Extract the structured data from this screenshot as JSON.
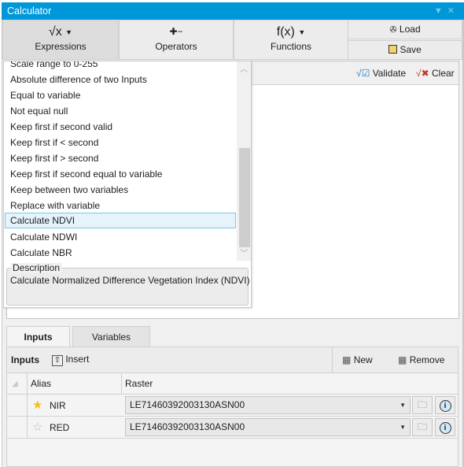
{
  "window": {
    "title": "Calculator"
  },
  "ribbon": {
    "expressions": {
      "label": "Expressions",
      "icon": "sqrt-x-icon"
    },
    "operators": {
      "label": "Operators",
      "icon": "operators-icon"
    },
    "functions": {
      "label": "Functions",
      "icon_text": "f(x)"
    },
    "load": {
      "label": "Load"
    },
    "save": {
      "label": "Save"
    }
  },
  "editor": {
    "validate_label": "Validate",
    "clear_label": "Clear",
    "content": ""
  },
  "expressions_dropdown": {
    "items": [
      "Scale range to 0-255",
      "Absolute difference of two Inputs",
      "Equal to variable",
      "Not equal null",
      "Keep first if second valid",
      "Keep first if < second",
      "Keep first if > second",
      "Keep first if second equal to variable",
      "Keep between two variables",
      "Replace with variable",
      "Calculate NDVI",
      "Calculate NDWI",
      "Calculate NBR"
    ],
    "selected_index": 10,
    "description_legend": "Description",
    "description": "Calculate Normalized Difference Vegetation Index (NDVI)"
  },
  "tabs": [
    {
      "label": "Inputs",
      "active": true
    },
    {
      "label": "Variables",
      "active": false
    }
  ],
  "inputs": {
    "toolbar_title": "Inputs",
    "insert_label": "Insert",
    "new_label": "New",
    "remove_label": "Remove",
    "columns": [
      "Alias",
      "Raster"
    ],
    "rows": [
      {
        "alias": "NIR",
        "raster": "LE71460392003130ASN00",
        "starred": true
      },
      {
        "alias": "RED",
        "raster": "LE71460392003130ASN00",
        "starred": false
      }
    ]
  }
}
